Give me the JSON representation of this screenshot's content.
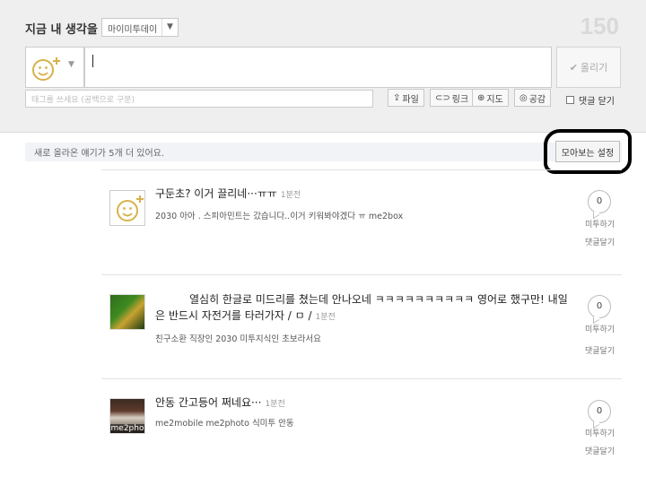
{
  "compose": {
    "title": "지금 내 생각을",
    "me2_type": "마이미투데이",
    "char_count": "150",
    "post_label": "올리기",
    "tag_placeholder": "태그를 쓰세요 (공백으로 구분)",
    "tools": [
      "파일",
      "링크",
      "지도",
      "공감"
    ],
    "reply_close_label": "댓글 닫기"
  },
  "notice": {
    "text": "새로 올라온 얘기가 5개 더 있어요.",
    "settings_label": "모아보는 설정"
  },
  "posts": [
    {
      "title": "구둔초? 이거 끌리네···ㅠㅠ",
      "time": "1분전",
      "tags": "2030 아아 . 스피아민트는 갔습니다..이거 키워봐야겠다 ㅠ me2box",
      "me2_count": "0",
      "me2_label": "미투하기",
      "reply_label": "댓글달기"
    },
    {
      "title": "열심히 한글로 미드리를 쳤는데 안나오네 ㅋㅋㅋㅋㅋㅋㅋㅋㅋㅋ 영어로 했구만! 내일은 반드시 자전거를 타러가자 / ㅁ /",
      "time": "1분전",
      "tags": "친구소환 직장인 2030 미투지식인 초보라서요",
      "me2_count": "0",
      "me2_label": "미투하기",
      "reply_label": "댓글달기"
    },
    {
      "title": "안동 간고등어 쩌네요···",
      "time": "1분전",
      "tags": "me2mobile me2photo  식미투 안동",
      "photo_label": "me2pho",
      "me2_count": "0",
      "me2_label": "미투하기",
      "reply_label": "댓글달기"
    }
  ]
}
